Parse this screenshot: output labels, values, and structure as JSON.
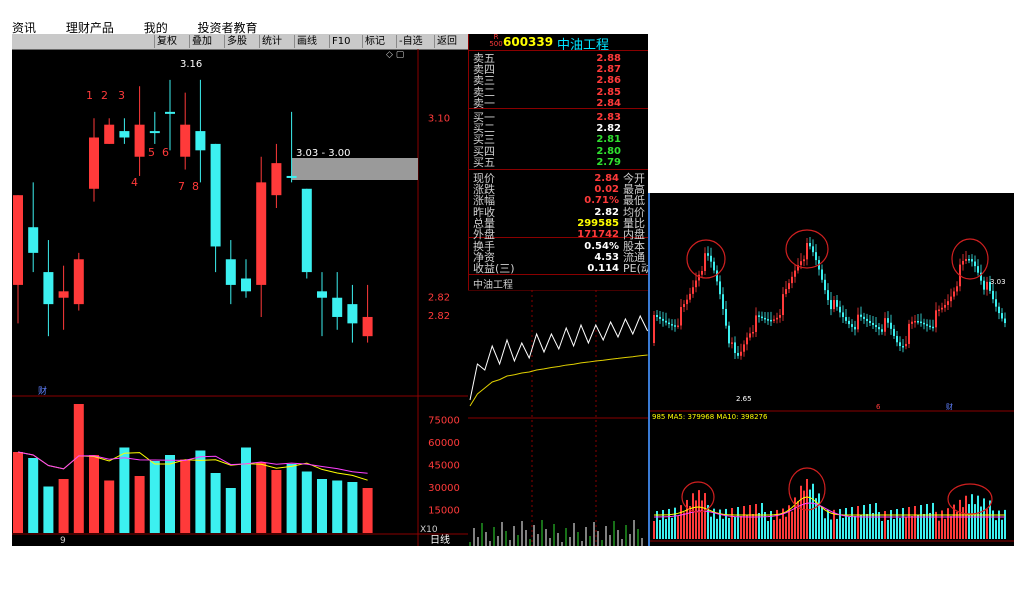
{
  "menu": {
    "items": [
      "资讯",
      "理财产品",
      "我的",
      "投资者教育"
    ]
  },
  "toolbar": {
    "buttons": [
      "复权",
      "叠加",
      "多股",
      "统计",
      "画线",
      "F10",
      "标记",
      "-自选",
      "返回"
    ]
  },
  "kline": {
    "price_labels": [
      "3.16",
      "3.03 - 3.00",
      "2.82"
    ],
    "annotations": [
      "1",
      "2",
      "3",
      "4",
      "5",
      "6",
      "7",
      "8"
    ],
    "fin_marker": "财",
    "volume_multiplier": "X10",
    "period": "日线",
    "month_tick": "9"
  },
  "quote": {
    "badge_top": "R",
    "badge_bottom": "500",
    "code": "600339",
    "name": "中油工程",
    "ask": [
      {
        "label": "卖五",
        "price": "2.88"
      },
      {
        "label": "卖四",
        "price": "2.87"
      },
      {
        "label": "卖三",
        "price": "2.86"
      },
      {
        "label": "卖二",
        "price": "2.85"
      },
      {
        "label": "卖一",
        "price": "2.84"
      }
    ],
    "bid": [
      {
        "label": "买一",
        "price": "2.83"
      },
      {
        "label": "买二",
        "price": "2.82"
      },
      {
        "label": "买三",
        "price": "2.81"
      },
      {
        "label": "买四",
        "price": "2.80"
      },
      {
        "label": "买五",
        "price": "2.79"
      }
    ],
    "stats": [
      {
        "label": "现价",
        "value": "2.84",
        "tail": "今开"
      },
      {
        "label": "涨跌",
        "value": "0.02",
        "tail": "最高"
      },
      {
        "label": "涨幅",
        "value": "0.71%",
        "tail": "最低"
      },
      {
        "label": "昨收",
        "value": "2.82",
        "tail": "均价"
      },
      {
        "label": "总量",
        "value": "299585",
        "tail": "量比"
      },
      {
        "label": "外盘",
        "value": "171742",
        "tail": "内盘"
      }
    ],
    "finance": [
      {
        "label": "换手",
        "value": "0.54%",
        "tail": "股本"
      },
      {
        "label": "净资",
        "value": "4.53",
        "tail": "流通"
      },
      {
        "label": "收益(三)",
        "value": "0.114",
        "tail": "PE(动)"
      }
    ]
  },
  "intraday": {
    "title": "中油工程"
  },
  "inset": {
    "low_label": "2.65",
    "right_label": "3.03",
    "ma_legend": "985  MA5: 379968  MA10: 398276",
    "month_tick": "6",
    "fin_marker": "财"
  },
  "chart_data": [
    {
      "type": "candlestick",
      "title": "",
      "y_tick_labels": [
        "3.10",
        "2.82"
      ],
      "candles": [
        {
          "o": 2.84,
          "h": 2.98,
          "l": 2.78,
          "c": 2.98,
          "dir": "up"
        },
        {
          "o": 2.93,
          "h": 3.0,
          "l": 2.86,
          "c": 2.89,
          "dir": "down"
        },
        {
          "o": 2.81,
          "h": 2.91,
          "l": 2.76,
          "c": 2.86,
          "dir": "down"
        },
        {
          "o": 2.83,
          "h": 2.87,
          "l": 2.77,
          "c": 2.82,
          "dir": "up"
        },
        {
          "o": 2.81,
          "h": 2.89,
          "l": 2.8,
          "c": 2.88,
          "dir": "up"
        },
        {
          "o": 2.99,
          "h": 3.1,
          "l": 2.97,
          "c": 3.07,
          "dir": "up"
        },
        {
          "o": 3.09,
          "h": 3.1,
          "l": 3.06,
          "c": 3.06,
          "dir": "up"
        },
        {
          "o": 3.08,
          "h": 3.1,
          "l": 3.06,
          "c": 3.07,
          "dir": "down"
        },
        {
          "o": 3.09,
          "h": 3.15,
          "l": 3.01,
          "c": 3.04,
          "dir": "up"
        },
        {
          "o": 3.08,
          "h": 3.11,
          "l": 3.06,
          "c": 3.08,
          "dir": "down"
        },
        {
          "o": 3.11,
          "h": 3.16,
          "l": 3.05,
          "c": 3.11,
          "dir": "down"
        },
        {
          "o": 3.09,
          "h": 3.14,
          "l": 3.02,
          "c": 3.04,
          "dir": "up"
        },
        {
          "o": 3.08,
          "h": 3.16,
          "l": 3.0,
          "c": 3.05,
          "dir": "down"
        },
        {
          "o": 3.06,
          "h": 3.06,
          "l": 2.86,
          "c": 2.9,
          "dir": "down"
        },
        {
          "o": 2.88,
          "h": 2.91,
          "l": 2.81,
          "c": 2.84,
          "dir": "down"
        },
        {
          "o": 2.85,
          "h": 2.88,
          "l": 2.82,
          "c": 2.83,
          "dir": "down"
        },
        {
          "o": 2.84,
          "h": 3.04,
          "l": 2.79,
          "c": 3.0,
          "dir": "up"
        },
        {
          "o": 2.98,
          "h": 3.06,
          "l": 2.96,
          "c": 3.03,
          "dir": "up"
        },
        {
          "o": 3.01,
          "h": 3.11,
          "l": 3.0,
          "c": 3.01,
          "dir": "down"
        },
        {
          "o": 2.99,
          "h": 2.99,
          "l": 2.85,
          "c": 2.86,
          "dir": "down"
        },
        {
          "o": 2.83,
          "h": 2.86,
          "l": 2.76,
          "c": 2.82,
          "dir": "down"
        },
        {
          "o": 2.82,
          "h": 2.86,
          "l": 2.77,
          "c": 2.79,
          "dir": "down"
        },
        {
          "o": 2.81,
          "h": 2.84,
          "l": 2.75,
          "c": 2.78,
          "dir": "down"
        },
        {
          "o": 2.79,
          "h": 2.84,
          "l": 2.75,
          "c": 2.76,
          "dir": "up"
        }
      ],
      "volume_y_tick_labels": [
        "75000",
        "60000",
        "45000",
        "30000",
        "15000"
      ],
      "volumes": [
        54000,
        50000,
        31000,
        36000,
        86000,
        52000,
        35000,
        57000,
        38000,
        48000,
        52000,
        49000,
        55000,
        40000,
        30000,
        57000,
        47000,
        42000,
        46000,
        41000,
        36000,
        35000,
        34000,
        30000
      ],
      "volume_ylim": [
        0,
        88000
      ]
    },
    {
      "type": "line",
      "title": "中油工程",
      "series": [
        {
          "name": "",
          "values": [
            2.72,
            2.8,
            2.82,
            2.86,
            2.84,
            2.88,
            2.85,
            2.87,
            2.86,
            2.9,
            2.88,
            2.9,
            2.89,
            2.92,
            2.9,
            2.93,
            2.91,
            2.93,
            2.92,
            2.94,
            2.93,
            2.95,
            2.94,
            2.96,
            2.95
          ]
        }
      ]
    }
  ]
}
